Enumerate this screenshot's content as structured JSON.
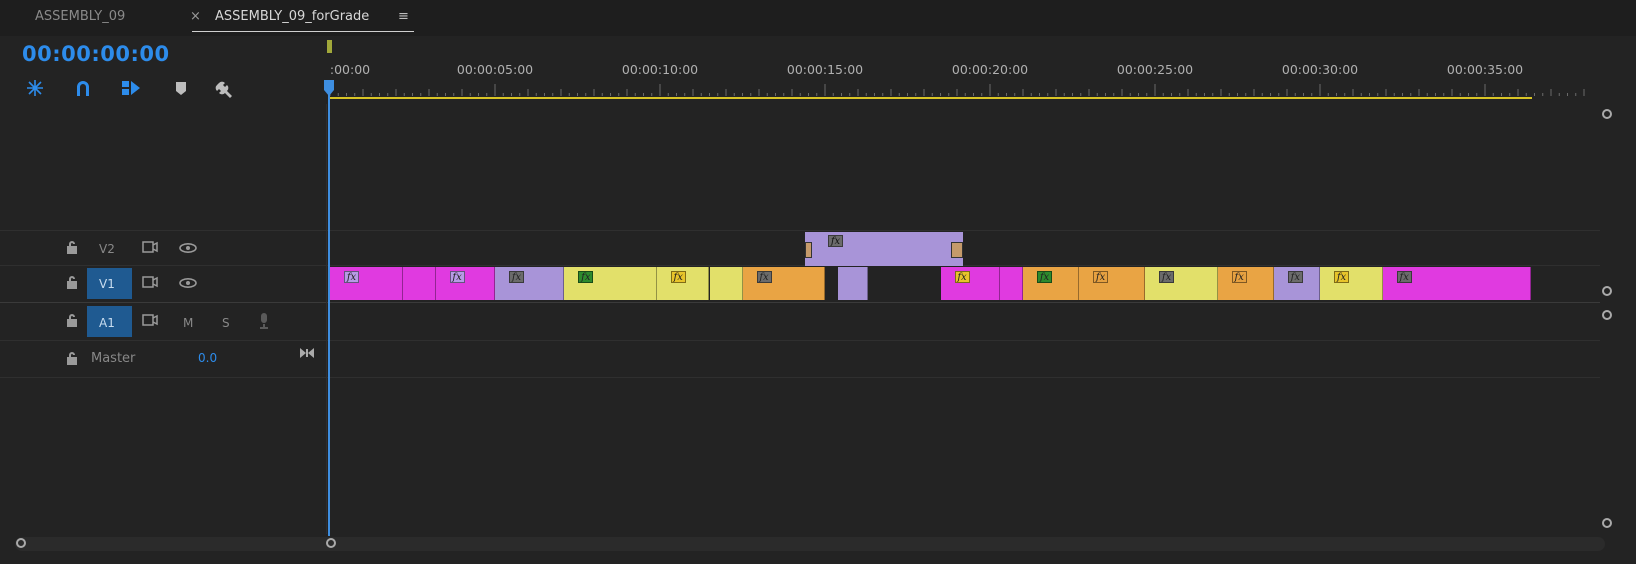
{
  "tabs": [
    {
      "label": "ASSEMBLY_09",
      "active": false
    },
    {
      "label": "ASSEMBLY_09_forGrade",
      "active": true
    }
  ],
  "tab_close_glyph": "×",
  "tab_menu_glyph": "≡",
  "timecode": "00:00:00:00",
  "toolbar": [
    {
      "icon": "nest-sequence-icon"
    },
    {
      "icon": "snap-magnet-icon"
    },
    {
      "icon": "linked-selection-icon"
    },
    {
      "icon": "add-marker-icon"
    },
    {
      "icon": "wrench-settings-icon"
    }
  ],
  "ruler": {
    "labels": [
      ":00:00",
      "00:00:05:00",
      "00:00:10:00",
      "00:00:15:00",
      "00:00:20:00",
      "00:00:25:00",
      "00:00:30:00",
      "00:00:35:00"
    ]
  },
  "tracks": {
    "v2": {
      "label": "V2"
    },
    "v1": {
      "label": "V1"
    },
    "a1": {
      "label": "A1",
      "mute": "M",
      "solo": "S"
    },
    "master": {
      "label": "Master",
      "value": "0.0"
    }
  },
  "colors": {
    "accent": "#2d8ceb",
    "magenta": "#e03ae0",
    "violet": "#a894d8",
    "yellow": "#e2e06a",
    "orange": "#e9a444",
    "workarea": "#d8c426"
  },
  "clips_v1": [
    {
      "color": "magenta",
      "start": 0.0,
      "end": 2.2,
      "badge": "fx-violet"
    },
    {
      "color": "magenta",
      "start": 2.2,
      "end": 3.2,
      "badge": ""
    },
    {
      "color": "magenta",
      "start": 3.2,
      "end": 5.0,
      "badge": "fx-violet"
    },
    {
      "color": "violet",
      "start": 5.0,
      "end": 7.1,
      "badge": "fx-dark"
    },
    {
      "color": "yellow",
      "start": 7.1,
      "end": 9.9,
      "badge": "fx-green"
    },
    {
      "color": "yellow",
      "start": 9.9,
      "end": 11.5,
      "badge": "fx-yellow"
    },
    {
      "color": "yellow",
      "start": 11.5,
      "end": 12.5,
      "badge": ""
    },
    {
      "color": "orange",
      "start": 12.5,
      "end": 15.0,
      "badge": "fx-dark"
    },
    {
      "color": "violet",
      "start": 15.4,
      "end": 16.3,
      "badge": ""
    },
    {
      "color": "magenta",
      "start": 18.5,
      "end": 20.3,
      "badge": "fx-yellow"
    },
    {
      "color": "magenta",
      "start": 20.3,
      "end": 21.0,
      "badge": ""
    },
    {
      "color": "orange",
      "start": 21.0,
      "end": 22.7,
      "badge": "fx-green"
    },
    {
      "color": "orange",
      "start": 22.7,
      "end": 24.7,
      "badge": "fx-orange"
    },
    {
      "color": "yellow",
      "start": 24.7,
      "end": 26.9,
      "badge": "fx-dark"
    },
    {
      "color": "orange",
      "start": 26.9,
      "end": 28.6,
      "badge": "fx-orange"
    },
    {
      "color": "violet",
      "start": 28.6,
      "end": 30.0,
      "badge": "fx-dark"
    },
    {
      "color": "yellow",
      "start": 30.0,
      "end": 31.9,
      "badge": "fx-yellow"
    },
    {
      "color": "magenta",
      "start": 31.9,
      "end": 36.4,
      "badge": "fx-dark"
    }
  ],
  "clip_v2": {
    "color": "violet",
    "start": 14.6,
    "end": 19.4,
    "badge": "fx-dark"
  }
}
